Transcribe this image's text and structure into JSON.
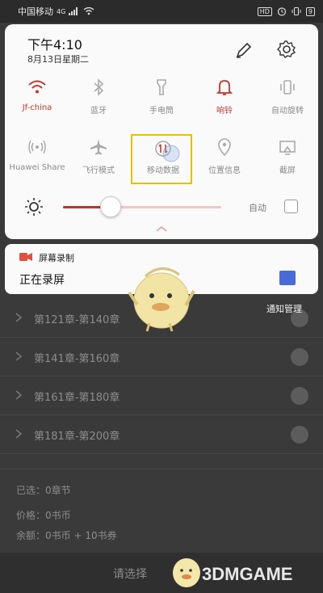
{
  "status_bar": {
    "carrier": "中国移动",
    "network": "4G",
    "hd": "HD",
    "battery": "9"
  },
  "quick_settings": {
    "time": "下午4:10",
    "date": "8月13日星期二",
    "tiles": [
      {
        "label": "Jf-china",
        "icon": "wifi-icon",
        "active": true
      },
      {
        "label": "蓝牙",
        "icon": "bluetooth-icon",
        "active": false
      },
      {
        "label": "手电筒",
        "icon": "flashlight-icon",
        "active": false
      },
      {
        "label": "响铃",
        "icon": "bell-icon",
        "active": true
      },
      {
        "label": "自动旋转",
        "icon": "auto-rotate-icon",
        "active": false
      },
      {
        "label": "Huawei Share",
        "icon": "huawei-share-icon",
        "active": false
      },
      {
        "label": "飞行模式",
        "icon": "airplane-icon",
        "active": false
      },
      {
        "label": "移动数据",
        "icon": "mobile-data-icon",
        "active": false,
        "highlighted": true
      },
      {
        "label": "位置信息",
        "icon": "location-icon",
        "active": false
      },
      {
        "label": "截屏",
        "icon": "screenshot-icon",
        "active": false
      }
    ],
    "brightness": {
      "level": 0.3,
      "auto_label": "自动",
      "auto_checked": false
    }
  },
  "notification": {
    "app_name": "屏幕录制",
    "text": "正在录屏",
    "manage_label": "通知管理"
  },
  "background": {
    "chapters": [
      "第121章-第140章",
      "第141章-第160章",
      "第161章-第180章",
      "第181章-第200章"
    ],
    "selected": "已选：0章节",
    "price": "价格：0书币",
    "balance": "余额：0书币 + 10书券",
    "button": "请选择",
    "watermark": "3DMGAME"
  },
  "colors": {
    "accent": "#b03a2e",
    "highlight_box": "#e8c200",
    "notif_thumb": "#4a6ad8"
  }
}
